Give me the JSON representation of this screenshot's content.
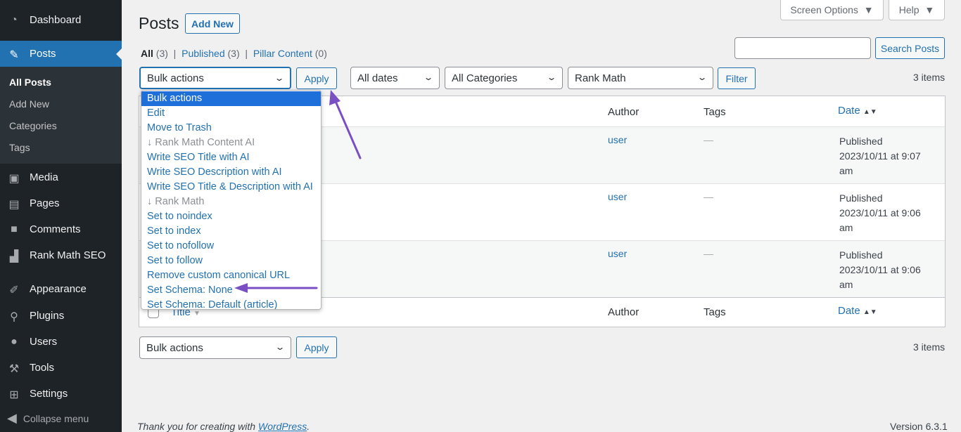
{
  "sidebar": {
    "items": [
      {
        "label": "Dashboard",
        "icon": "dashboard-icon"
      },
      {
        "label": "Posts",
        "icon": "pin-icon",
        "active": true
      },
      {
        "label": "Media",
        "icon": "media-icon"
      },
      {
        "label": "Pages",
        "icon": "pages-icon"
      },
      {
        "label": "Comments",
        "icon": "comments-icon"
      },
      {
        "label": "Rank Math SEO",
        "icon": "rank-math-icon"
      },
      {
        "label": "Appearance",
        "icon": "brush-icon"
      },
      {
        "label": "Plugins",
        "icon": "plugin-icon"
      },
      {
        "label": "Users",
        "icon": "users-icon"
      },
      {
        "label": "Tools",
        "icon": "wrench-icon"
      },
      {
        "label": "Settings",
        "icon": "settings-icon"
      }
    ],
    "submenu": [
      "All Posts",
      "Add New",
      "Categories",
      "Tags"
    ],
    "collapse": "Collapse menu"
  },
  "header": {
    "screen_options": "Screen Options",
    "help": "Help",
    "title": "Posts",
    "add_new": "Add New"
  },
  "views": {
    "all": "All",
    "all_count": "(3)",
    "published": "Published",
    "published_count": "(3)",
    "pillar": "Pillar Content",
    "pillar_count": "(0)"
  },
  "search": {
    "value": "",
    "button": "Search Posts"
  },
  "filters": {
    "bulk": "Bulk actions",
    "apply": "Apply",
    "dates": "All dates",
    "categories": "All Categories",
    "rankmath": "Rank Math",
    "filter": "Filter",
    "items": "3 items"
  },
  "table": {
    "columns": {
      "title": "Title",
      "author": "Author",
      "tags": "Tags",
      "date": "Date"
    },
    "rows": [
      {
        "author": "user",
        "tags": "—",
        "status": "Published",
        "date": "2023/10/11 at 9:07",
        "ampm": "am"
      },
      {
        "author": "user",
        "tags": "—",
        "status": "Published",
        "date": "2023/10/11 at 9:06",
        "ampm": "am"
      },
      {
        "author": "user",
        "tags": "—",
        "status": "Published",
        "date": "2023/10/11 at 9:06",
        "ampm": "am"
      }
    ]
  },
  "dropdown": {
    "options": [
      "Bulk actions",
      "Edit",
      "Move to Trash",
      "↓ Rank Math Content AI",
      "Write SEO Title with AI",
      "Write SEO Description with AI",
      "Write SEO Title & Description with AI",
      "↓ Rank Math",
      "Set to noindex",
      "Set to index",
      "Set to nofollow",
      "Set to follow",
      "Remove custom canonical URL",
      "Set Schema: None",
      "Set Schema: Default (article)"
    ]
  },
  "footer": {
    "thanks": "Thank you for creating with ",
    "wp": "WordPress",
    "period": ".",
    "version": "Version 6.3.1"
  },
  "colors": {
    "accent": "#2271b1",
    "sidebar": "#1d2327",
    "annotation_arrow": "#7b4fc4"
  }
}
